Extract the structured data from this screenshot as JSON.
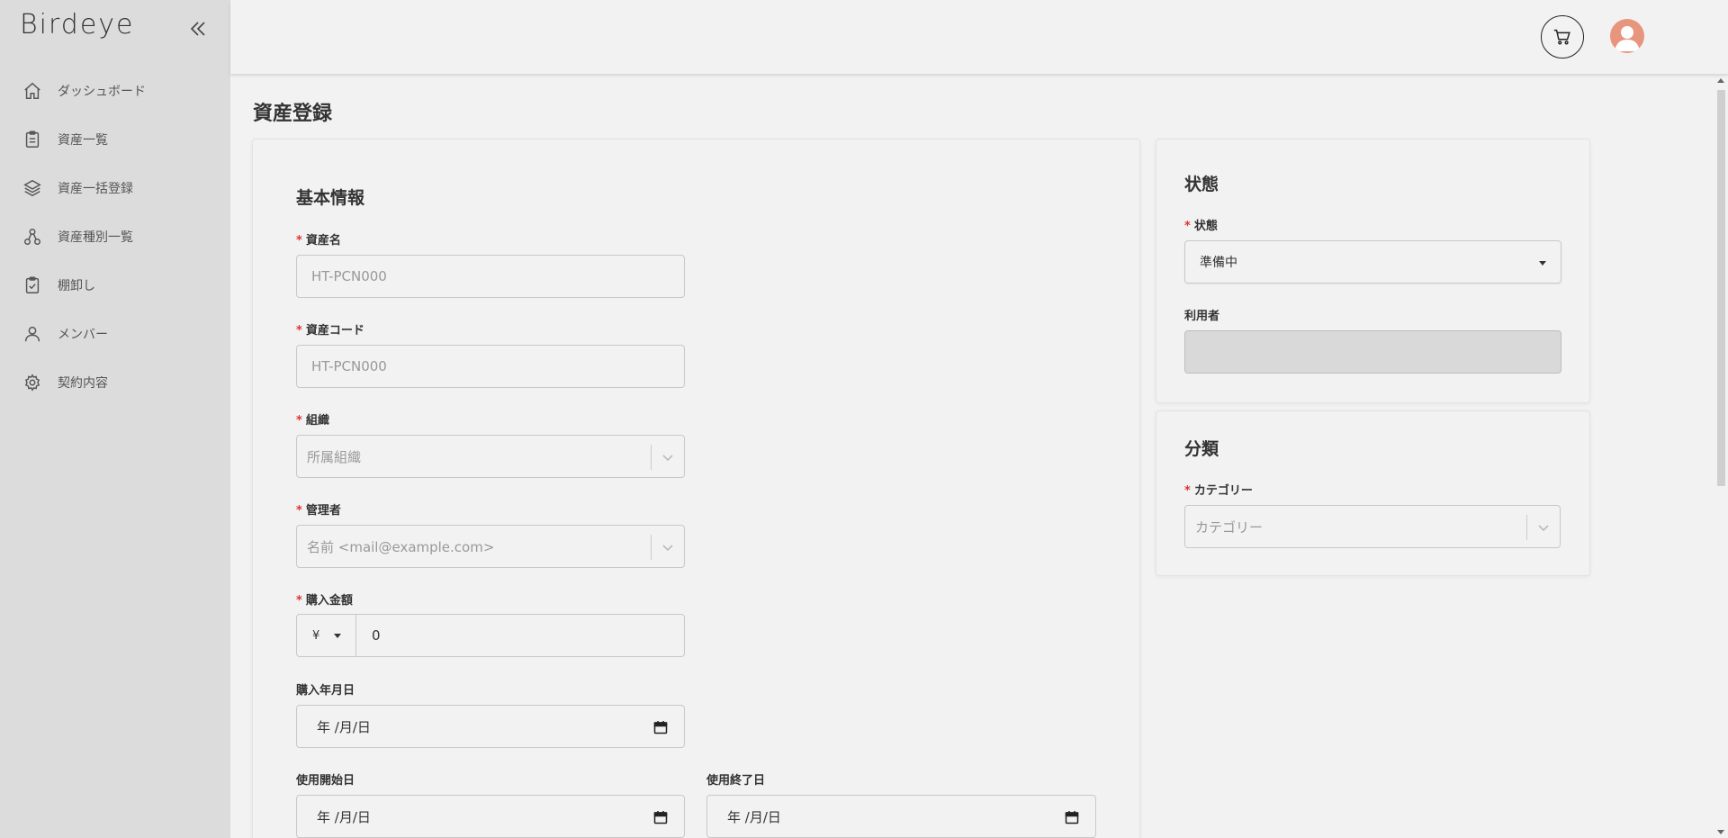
{
  "app": {
    "logo": "Birdeye"
  },
  "sidebar": {
    "items": [
      {
        "label": "ダッシュボード",
        "icon": "home-icon"
      },
      {
        "label": "資産一覧",
        "icon": "clipboard-icon"
      },
      {
        "label": "資産一括登録",
        "icon": "layers-icon"
      },
      {
        "label": "資産種別一覧",
        "icon": "hierarchy-icon"
      },
      {
        "label": "棚卸し",
        "icon": "clipboard-check-icon"
      },
      {
        "label": "メンバー",
        "icon": "user-icon"
      },
      {
        "label": "契約内容",
        "icon": "gear-icon"
      }
    ]
  },
  "page": {
    "title": "資産登録"
  },
  "basic": {
    "title": "基本情報",
    "asset_name": {
      "label": "資産名",
      "placeholder": "HT-PCN000"
    },
    "asset_code": {
      "label": "資産コード",
      "placeholder": "HT-PCN000"
    },
    "organization": {
      "label": "組織",
      "placeholder": "所属組織"
    },
    "manager": {
      "label": "管理者",
      "placeholder": "名前 <mail@example.com>"
    },
    "price": {
      "label": "購入金額",
      "currency": "¥",
      "value": "0"
    },
    "purchase_date": {
      "label": "購入年月日",
      "value": "年 /月/日"
    },
    "start_date": {
      "label": "使用開始日",
      "value": "年 /月/日"
    },
    "end_date": {
      "label": "使用終了日",
      "value": "年 /月/日"
    }
  },
  "status": {
    "title": "状態",
    "state": {
      "label": "状態",
      "value": "準備中"
    },
    "user": {
      "label": "利用者"
    }
  },
  "classification": {
    "title": "分類",
    "category": {
      "label": "カテゴリー",
      "placeholder": "カテゴリー"
    }
  },
  "required_mark": "*",
  "colors": {
    "sidebar_bg": "#dcdcdc",
    "page_bg": "#f2f2f2",
    "required": "#dd3333",
    "avatar": "#e8957e"
  }
}
